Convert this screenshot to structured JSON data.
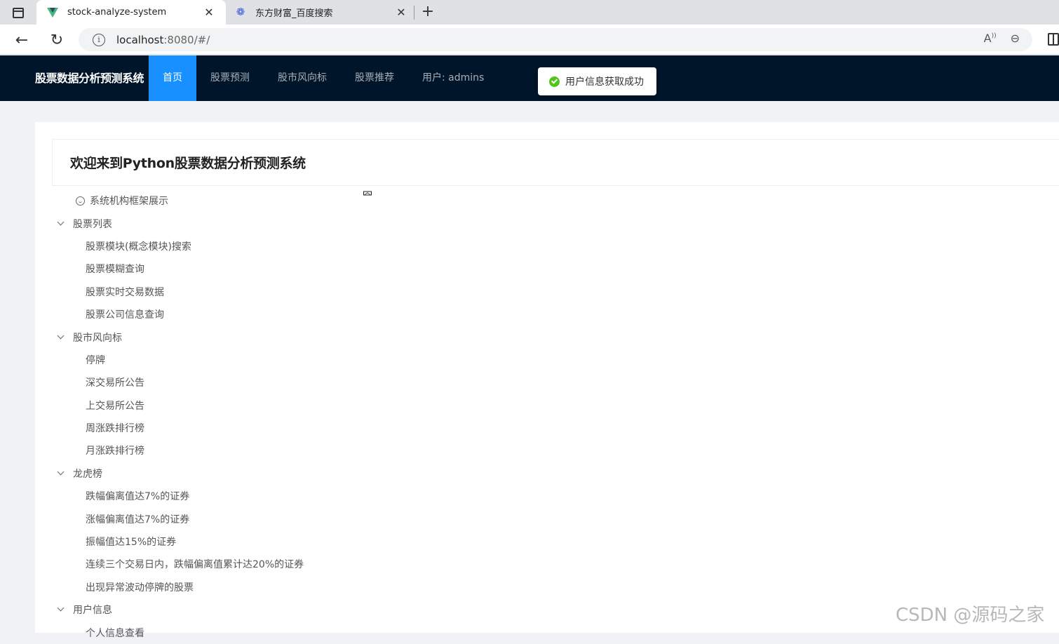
{
  "browser": {
    "tabs": [
      {
        "title": "stock-analyze-system",
        "icon": "vue-logo-icon",
        "active": true
      },
      {
        "title": "东方财富_百度搜索",
        "icon": "baidu-paw-icon",
        "active": false
      }
    ],
    "close_glyph": "✕",
    "new_tab_glyph": "+",
    "url_host": "localhost",
    "url_rest": ":8080/#/"
  },
  "app": {
    "brand": "股票数据分析预测系统",
    "menu": [
      {
        "label": "首页",
        "active": true
      },
      {
        "label": "股票预测"
      },
      {
        "label": "股市风向标"
      },
      {
        "label": "股票推荐"
      },
      {
        "label": "用户: admins"
      }
    ],
    "toast": "用户信息获取成功",
    "colors": {
      "header": "#001529",
      "accent": "#1890ff",
      "success": "#52c41a"
    }
  },
  "main": {
    "welcome_title": "欢迎来到Python股票数据分析预测系统",
    "tree": [
      {
        "label": "系统机构框架展示",
        "kind": "top"
      },
      {
        "label": "股票列表",
        "kind": "group"
      },
      {
        "label": "股票模块(概念模块)搜索",
        "kind": "leaf"
      },
      {
        "label": "股票模糊查询",
        "kind": "leaf"
      },
      {
        "label": "股票实时交易数据",
        "kind": "leaf"
      },
      {
        "label": "股票公司信息查询",
        "kind": "leaf"
      },
      {
        "label": "股市风向标",
        "kind": "group"
      },
      {
        "label": "停牌",
        "kind": "leaf"
      },
      {
        "label": "深交易所公告",
        "kind": "leaf"
      },
      {
        "label": "上交易所公告",
        "kind": "leaf"
      },
      {
        "label": "周涨跌排行榜",
        "kind": "leaf"
      },
      {
        "label": "月涨跌排行榜",
        "kind": "leaf"
      },
      {
        "label": "龙虎榜",
        "kind": "group"
      },
      {
        "label": "跌幅偏离值达7%的证券",
        "kind": "leaf"
      },
      {
        "label": "涨幅偏离值达7%的证券",
        "kind": "leaf"
      },
      {
        "label": "振幅值达15%的证券",
        "kind": "leaf"
      },
      {
        "label": "连续三个交易日内，跌幅偏离值累计达20%的证券",
        "kind": "leaf"
      },
      {
        "label": "出现异常波动停牌的股票",
        "kind": "leaf"
      },
      {
        "label": "用户信息",
        "kind": "group"
      },
      {
        "label": "个人信息查看",
        "kind": "leaf"
      }
    ]
  },
  "watermark": "CSDN @源码之家"
}
